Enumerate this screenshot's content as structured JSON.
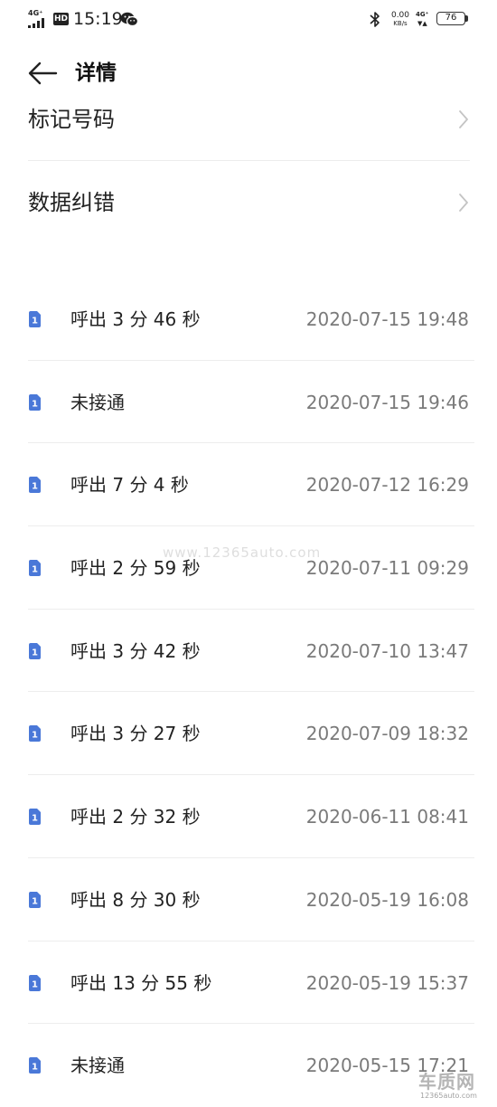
{
  "status_bar": {
    "network_left": "4G⁺",
    "hd_label": "HD",
    "time": "15:19",
    "net_speed_value": "0.00",
    "net_speed_unit": "KB/s",
    "network_right": "4G⁺",
    "battery": "76",
    "icons": [
      "signal-icon",
      "hd-icon",
      "wechat-icon",
      "bluetooth-icon",
      "battery-icon"
    ]
  },
  "header": {
    "title": "详情",
    "back_icon": "back-arrow-icon"
  },
  "menu": {
    "items": [
      {
        "label": "标记号码"
      },
      {
        "label": "数据纠错"
      }
    ]
  },
  "calls": [
    {
      "desc": "呼出 3 分 46 秒",
      "time": "2020-07-15 19:48"
    },
    {
      "desc": "未接通",
      "time": "2020-07-15 19:46"
    },
    {
      "desc": "呼出 7 分 4 秒",
      "time": "2020-07-12 16:29"
    },
    {
      "desc": "呼出 2 分 59 秒",
      "time": "2020-07-11 09:29"
    },
    {
      "desc": "呼出 3 分 42 秒",
      "time": "2020-07-10 13:47"
    },
    {
      "desc": "呼出 3 分 27 秒",
      "time": "2020-07-09 18:32"
    },
    {
      "desc": "呼出 2 分 32 秒",
      "time": "2020-06-11 08:41"
    },
    {
      "desc": "呼出 8 分 30 秒",
      "time": "2020-05-19 16:08"
    },
    {
      "desc": "呼出 13 分 55 秒",
      "time": "2020-05-19 15:37"
    },
    {
      "desc": "未接通",
      "time": "2020-05-15 17:21"
    }
  ],
  "sim_label": "1",
  "colors": {
    "sim_badge": "#4a78d8",
    "time_text": "#7a7a7a",
    "divider": "#ececec"
  },
  "watermark": {
    "middle": "www.12365auto.com",
    "logo_text": "车质网",
    "logo_url": "12365auto.com"
  }
}
